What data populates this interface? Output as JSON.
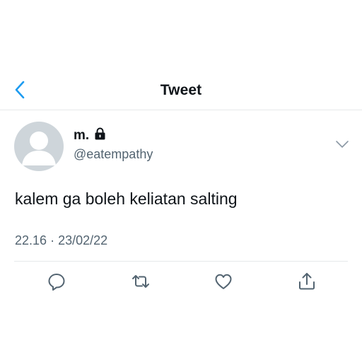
{
  "colors": {
    "accent": "#1d9bf0",
    "secondary_text": "#536471",
    "primary_text": "#0f1419",
    "avatar_bg": "#ced5da",
    "divider": "#e6e9ea"
  },
  "header": {
    "back_icon": "chevron-left-icon",
    "title": "Tweet"
  },
  "author": {
    "display_name": "m.",
    "protected_icon": "lock-icon",
    "handle": "@eatempathy",
    "avatar": "default-avatar"
  },
  "tweet": {
    "text": "kalem ga boleh keliatan salting",
    "time": "22.16",
    "separator": "·",
    "date": "23/02/22"
  },
  "actions": [
    {
      "icon": "reply-icon"
    },
    {
      "icon": "retweet-icon"
    },
    {
      "icon": "like-icon"
    },
    {
      "icon": "share-icon"
    }
  ]
}
